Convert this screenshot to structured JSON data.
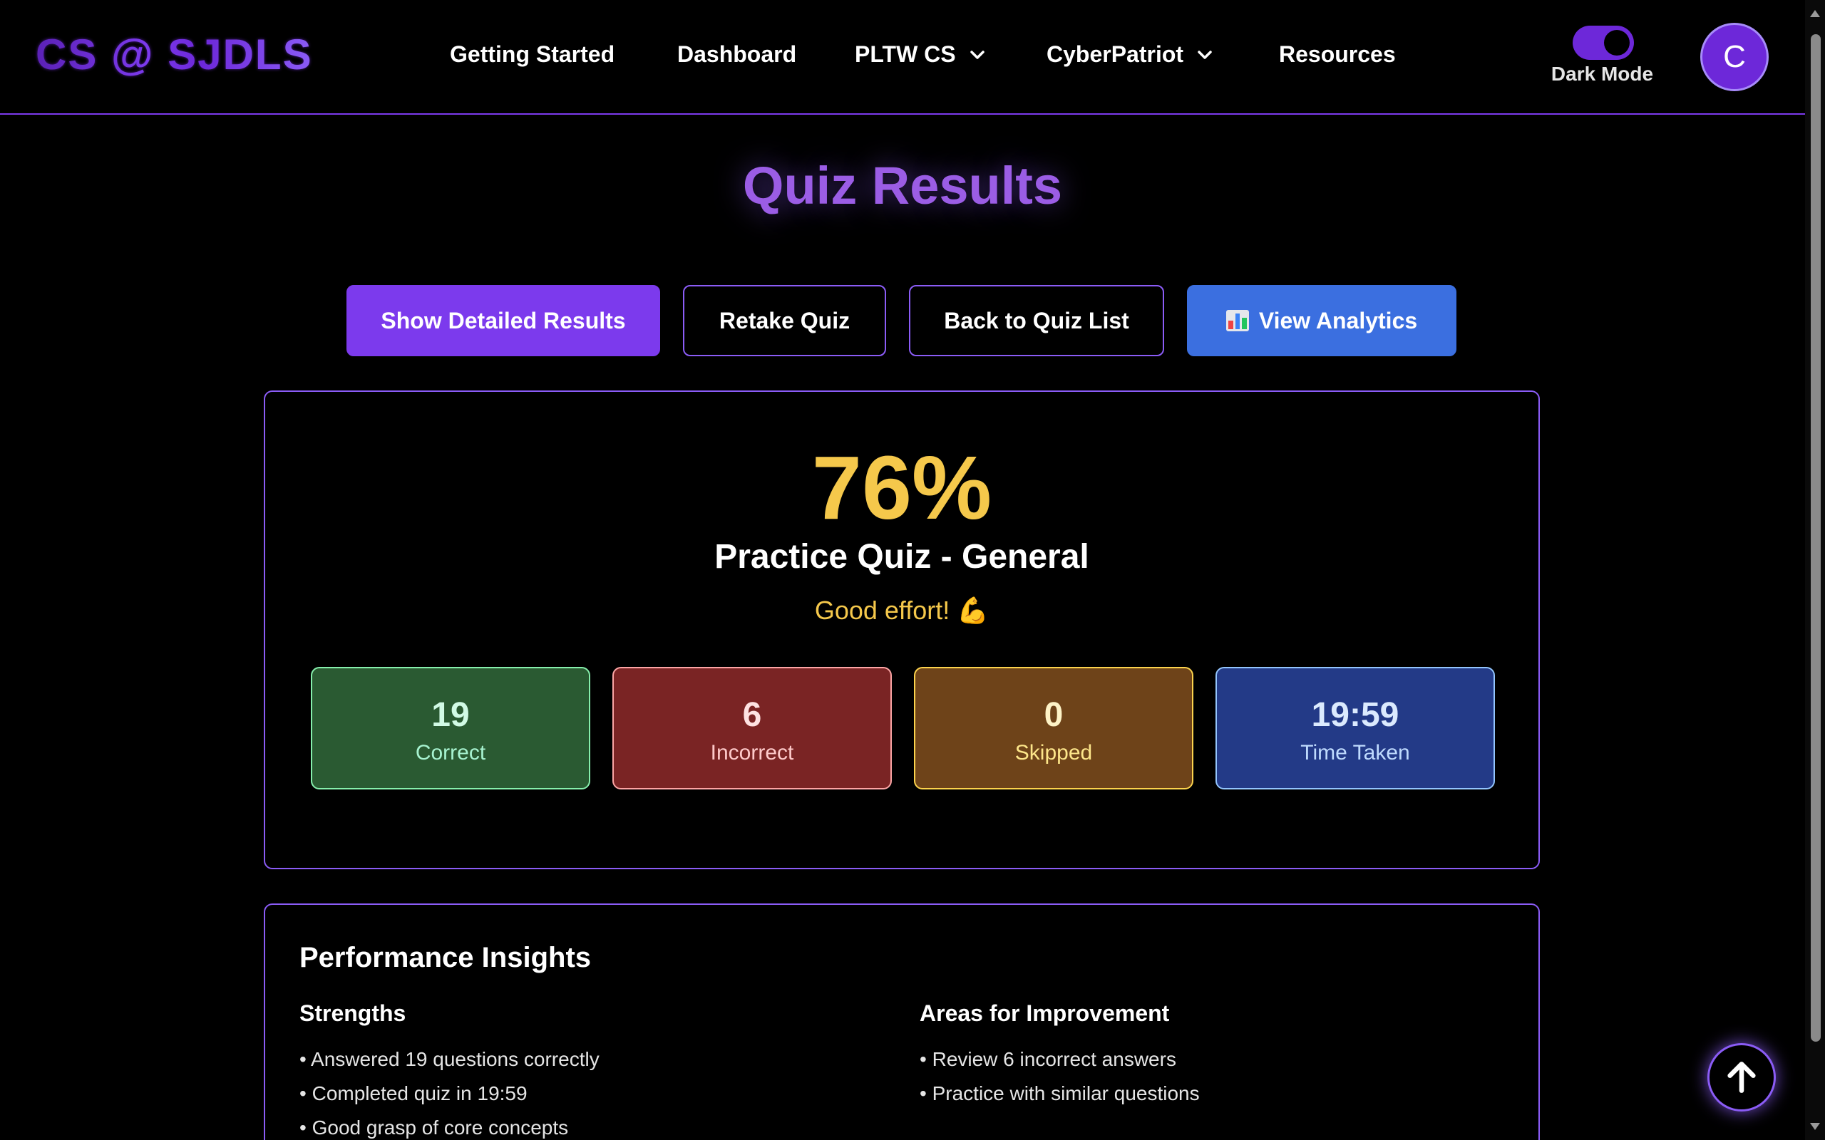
{
  "header": {
    "logo": "CS @ SJDLS",
    "nav": [
      {
        "label": "Getting Started",
        "dropdown": false
      },
      {
        "label": "Dashboard",
        "dropdown": false
      },
      {
        "label": "PLTW CS",
        "dropdown": true
      },
      {
        "label": "CyberPatriot",
        "dropdown": true
      },
      {
        "label": "Resources",
        "dropdown": false
      }
    ],
    "dark_mode_label": "Dark Mode",
    "dark_mode_on": true,
    "avatar_initial": "C"
  },
  "page": {
    "title": "Quiz Results"
  },
  "actions": {
    "detailed": "Show Detailed Results",
    "retake": "Retake Quiz",
    "back": "Back to Quiz List",
    "analytics": "View Analytics",
    "analytics_icon": "bar-chart-icon"
  },
  "result": {
    "score": "76%",
    "quiz_name": "Practice Quiz - General",
    "feedback": "Good effort! 💪",
    "stats": {
      "correct": {
        "value": "19",
        "label": "Correct"
      },
      "incorrect": {
        "value": "6",
        "label": "Incorrect"
      },
      "skipped": {
        "value": "0",
        "label": "Skipped"
      },
      "time": {
        "value": "19:59",
        "label": "Time Taken"
      }
    }
  },
  "insights": {
    "title": "Performance Insights",
    "strengths_title": "Strengths",
    "strengths": [
      "Answered 19 questions correctly",
      "Completed quiz in 19:59",
      "Good grasp of core concepts"
    ],
    "improve_title": "Areas for Improvement",
    "improvements": [
      "Review 6 incorrect answers",
      "Practice with similar questions"
    ]
  },
  "colors": {
    "accent": "#7c3aed",
    "score": "#f5c84b",
    "analytics_button": "#3b6fe0"
  }
}
